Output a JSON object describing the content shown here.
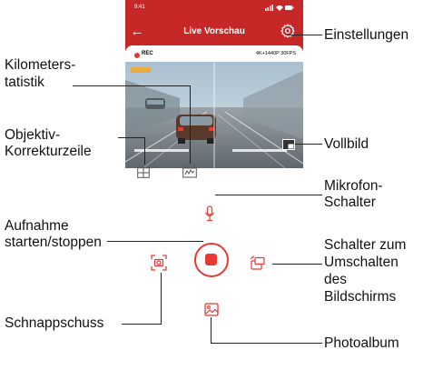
{
  "status": {
    "time": "9:41"
  },
  "header": {
    "title": "Live Vorschau"
  },
  "video": {
    "rec_label": "REC",
    "resolution": "4K+1440P 30FPS"
  },
  "callouts": {
    "settings": "Einstellungen",
    "km_stats_1": "Kilometers-",
    "km_stats_2": "tatistik",
    "lens_1": "Objektiv-",
    "lens_2": "Korrekturzeile",
    "fullscreen": "Vollbild",
    "mic_1": "Mikrofon-",
    "mic_2": "Schalter",
    "record_1": "Aufnahme",
    "record_2": "starten/stoppen",
    "switch_1": "Schalter zum",
    "switch_2": "Umschalten",
    "switch_3": "des",
    "switch_4": "Bildschirms",
    "snapshot": "Schnappschuss",
    "album": "Photoalbum"
  },
  "icons": [
    "back-arrow-icon",
    "gear-icon",
    "fullscreen-icon",
    "grid-icon",
    "odometer-icon",
    "microphone-icon",
    "camera-icon",
    "record-icon",
    "switch-screen-icon",
    "photo-album-icon"
  ],
  "colors": {
    "header": "#c62828",
    "accent": "#e53935"
  }
}
